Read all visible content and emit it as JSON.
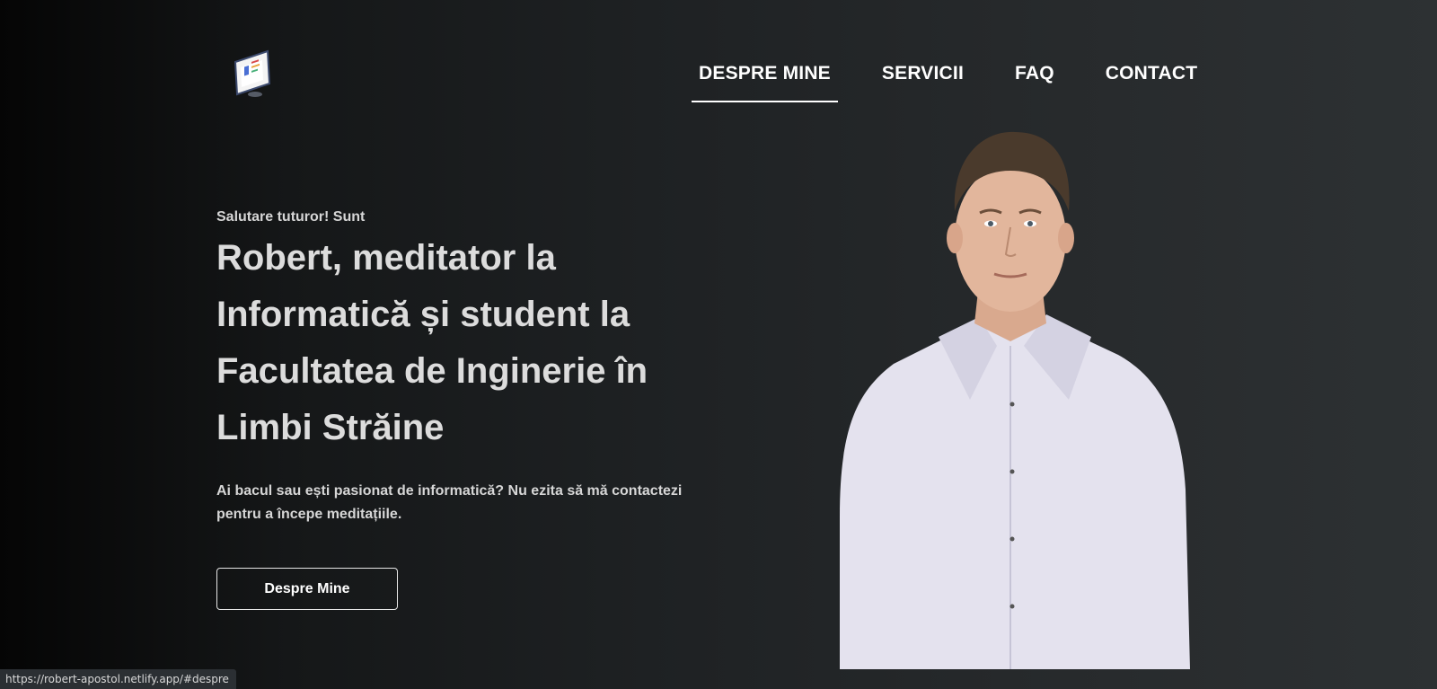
{
  "brand": {
    "logo_icon": "monitor-screen-icon"
  },
  "nav": {
    "items": [
      {
        "label": "DESPRE MINE",
        "active": true
      },
      {
        "label": "SERVICII",
        "active": false
      },
      {
        "label": "FAQ",
        "active": false
      },
      {
        "label": "CONTACT",
        "active": false
      }
    ]
  },
  "hero": {
    "greeting": "Salutare tuturor! Sunt",
    "headline": "Robert, meditator la Informatică și student la Facultatea de Inginerie în Limbi Străine",
    "description": "Ai bacul sau ești pasionat de informatică? Nu ezita să mă contactezi pentru a începe meditațiile.",
    "cta_label": "Despre Mine"
  },
  "status_bar": {
    "url": "https://robert-apostol.netlify.app/#despre"
  },
  "colors": {
    "background_start": "#050505",
    "background_end": "#2d3133",
    "text": "#dcdcdc",
    "shirt": "#e4e2ee"
  }
}
